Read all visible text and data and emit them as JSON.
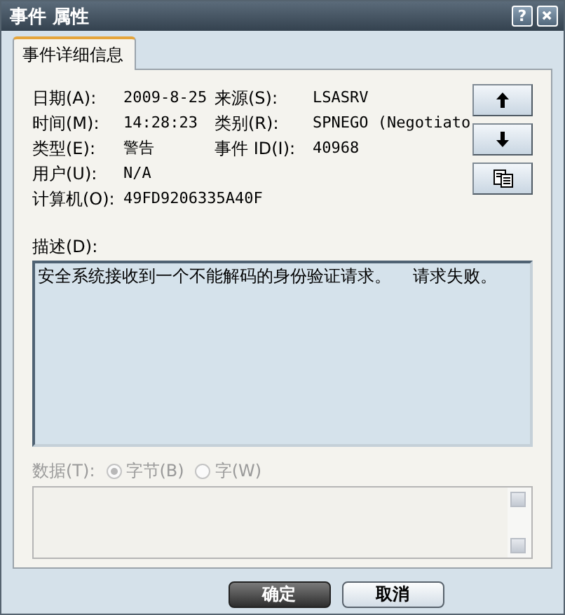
{
  "window": {
    "title": "事件 属性",
    "help_button": "?"
  },
  "tabs": [
    {
      "label": "事件详细信息",
      "selected": true
    }
  ],
  "info_rows": [
    [
      {
        "label": "日期(A):",
        "value": "2009-8-25"
      },
      {
        "label": "来源(S):",
        "value": "LSASRV"
      }
    ],
    [
      {
        "label": "时间(M):",
        "value": "14:28:23"
      },
      {
        "label": "类别(R):",
        "value": "SPNEGO (Negotiato"
      }
    ],
    [
      {
        "label": "类型(E):",
        "value": "警告"
      },
      {
        "label": "事件 ID(I):",
        "value": "40968"
      }
    ],
    [
      {
        "label": "用户(U):",
        "value": "N/A"
      }
    ],
    [
      {
        "label": "计算机(O):",
        "value": "49FD9206335A40F"
      }
    ]
  ],
  "side_buttons": [
    {
      "kind": "up"
    },
    {
      "kind": "down"
    },
    {
      "kind": "copy"
    }
  ],
  "description": {
    "label": "描述(D):",
    "value": "安全系统接收到一个不能解码的身份验证请求。    请求失败。"
  },
  "data": {
    "label": "数据(T):",
    "disabled": true,
    "options": [
      {
        "label": "字节(B)",
        "selected": true
      },
      {
        "label": "字(W)",
        "selected": false
      }
    ]
  },
  "buttons": [
    {
      "label": "确定",
      "default": true
    },
    {
      "label": "取消",
      "default": false
    }
  ]
}
